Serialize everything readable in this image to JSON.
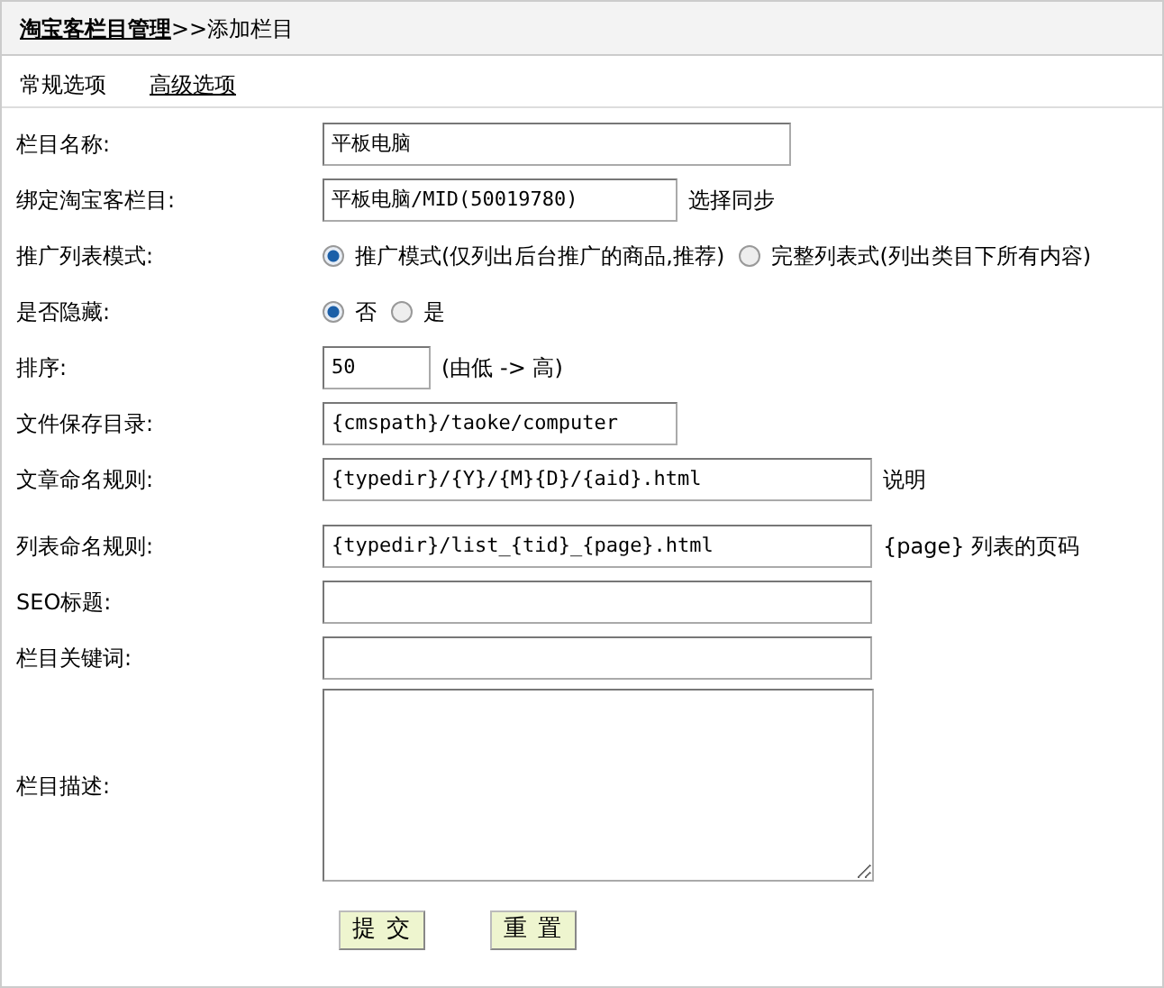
{
  "header": {
    "breadcrumb_link": "淘宝客栏目管理",
    "breadcrumb_rest": ">>添加栏目"
  },
  "tabs": [
    {
      "label": "常规选项",
      "selected": true
    },
    {
      "label": "高级选项",
      "selected": false
    }
  ],
  "rows": [
    {
      "label": "栏目名称:",
      "kind": "text",
      "value": "平板电脑"
    },
    {
      "label": "绑定淘宝客栏目:",
      "kind": "text",
      "value": "平板电脑/MID(50019780)",
      "note": "选择同步"
    },
    {
      "label": "推广列表模式:",
      "kind": "radio",
      "options": [
        {
          "label": "推广模式(仅列出后台推广的商品,推荐)",
          "selected": true
        },
        {
          "label": "完整列表式(列出类目下所有内容)",
          "selected": false
        }
      ]
    },
    {
      "label": "是否隐藏:",
      "kind": "radio",
      "options": [
        {
          "label": "否",
          "selected": true
        },
        {
          "label": "是",
          "selected": false
        }
      ]
    },
    {
      "label": "排序:",
      "kind": "text",
      "value": "50",
      "note": "(由低 -> 高)"
    },
    {
      "label": "文件保存目录:",
      "kind": "text",
      "value": "{cmspath}/taoke/computer"
    },
    {
      "label": "文章命名规则:",
      "kind": "text",
      "value": "{typedir}/{Y}/{M}{D}/{aid}.html",
      "note": "说明"
    },
    {
      "label": "列表命名规则:",
      "kind": "text",
      "value": "{typedir}/list_{tid}_{page}.html",
      "note": "{page} 列表的页码"
    },
    {
      "label": "SEO标题:",
      "kind": "text"
    },
    {
      "label": "栏目关键词:",
      "kind": "text"
    },
    {
      "label": "栏目描述:",
      "kind": "textarea"
    }
  ],
  "buttons": [
    "提 交",
    "重 置"
  ]
}
